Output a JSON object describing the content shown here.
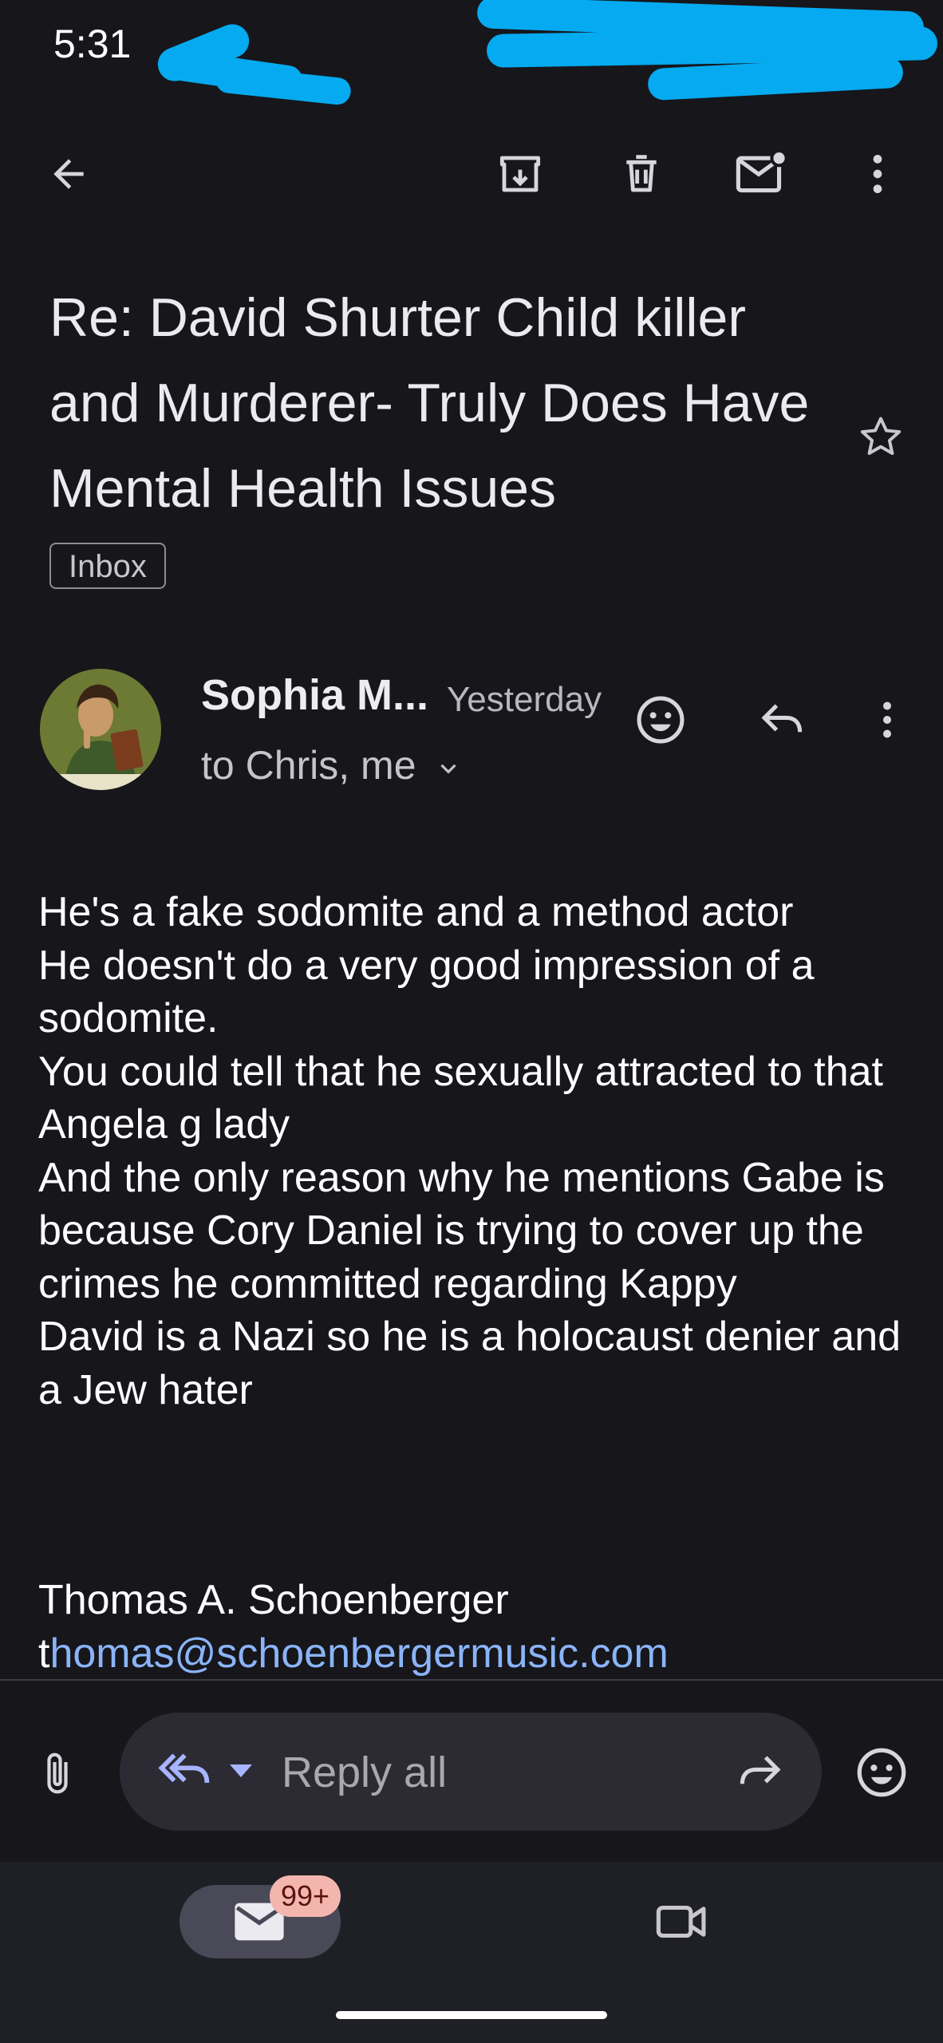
{
  "status_bar": {
    "time": "5:31"
  },
  "toolbar": {
    "back_icon": "arrow-back-icon",
    "archive_icon": "archive-icon",
    "delete_icon": "trash-icon",
    "mark_unread_icon": "mail-unread-icon",
    "more_icon": "more-vert-icon"
  },
  "email": {
    "subject": "Re: David Shurter Child killer and Murderer- Truly Does Have Mental Health Issues",
    "label": "Inbox",
    "sender": "Sophia M...",
    "time": "Yesterday",
    "recipients": "to Chris, me",
    "body": "He's a fake sodomite and a method actor\nHe doesn't do a very good impression of a sodomite.\nYou could tell that he sexually attracted to that Angela g lady\nAnd the only reason why he mentions Gabe is because Cory Daniel is trying to cover up the crimes he committed regarding Kappy\nDavid is a Nazi so he is a holocaust denier and a Jew hater",
    "signature_name": "Thomas A. Schoenberger",
    "signature_email_first": "t",
    "signature_email_rest": "homas@schoenbergermusic.com"
  },
  "reply_bar": {
    "placeholder": "Reply all"
  },
  "bottom_nav": {
    "mail_badge": "99+"
  },
  "colors": {
    "background": "#16161b",
    "link": "#8bb4f8",
    "accent": "#a8b4ff",
    "badge": "#f3b6ae"
  }
}
